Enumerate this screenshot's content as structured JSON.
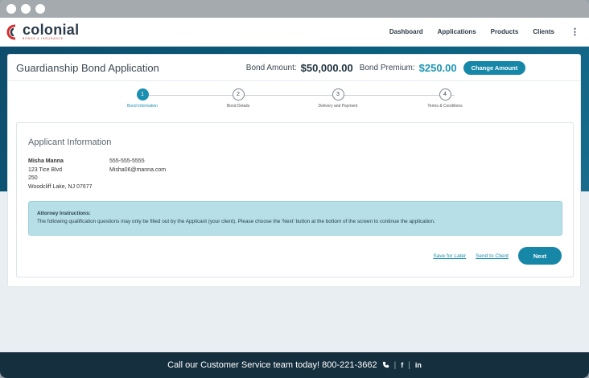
{
  "window": {
    "dots": 3
  },
  "nav": {
    "logo_word": "colonial",
    "logo_sub": "BONDS & INSURANCE",
    "links": [
      "Dashboard",
      "Applications",
      "Products",
      "Clients"
    ],
    "menu_icon": "⋮"
  },
  "header": {
    "title": "Guardianship Bond Application",
    "bond_amount_label": "Bond Amount:",
    "bond_amount": "$50,000.00",
    "bond_premium_label": "Bond Premium:",
    "bond_premium": "$250.00",
    "change_amount_label": "Change Amount"
  },
  "steps": [
    {
      "num": "1",
      "label": "Bond Information",
      "active": true
    },
    {
      "num": "2",
      "label": "Bond Details",
      "active": false
    },
    {
      "num": "3",
      "label": "Delivery and Payment",
      "active": false
    },
    {
      "num": "4",
      "label": "Terms & Conditions",
      "active": false
    }
  ],
  "applicant": {
    "section_title": "Applicant Information",
    "name": "Misha Manna",
    "address1": "123 Tice Blvd",
    "address2": "250",
    "city_state_zip": "Woodcliff Lake, NJ 07677",
    "phone": "555-555-5555",
    "email": "Misha06@manna.com"
  },
  "notice": {
    "title": "Attorney Instructions:",
    "text": "The following qualification questions may only be filled out by the Applicant (your client). Please choose the 'Next' button at the bottom of the screen to continue the application."
  },
  "actions": {
    "save_later": "Save for Later",
    "send_client": "Send to Client",
    "next": "Next"
  },
  "footer": {
    "text": "Call our Customer Service team today! 800-221-3662",
    "facebook": "f",
    "linkedin": "in"
  },
  "colors": {
    "accent": "#1787a8",
    "premium": "#1d97b2",
    "footer_bg": "#162f3e",
    "hero": "#0e4c6b"
  }
}
